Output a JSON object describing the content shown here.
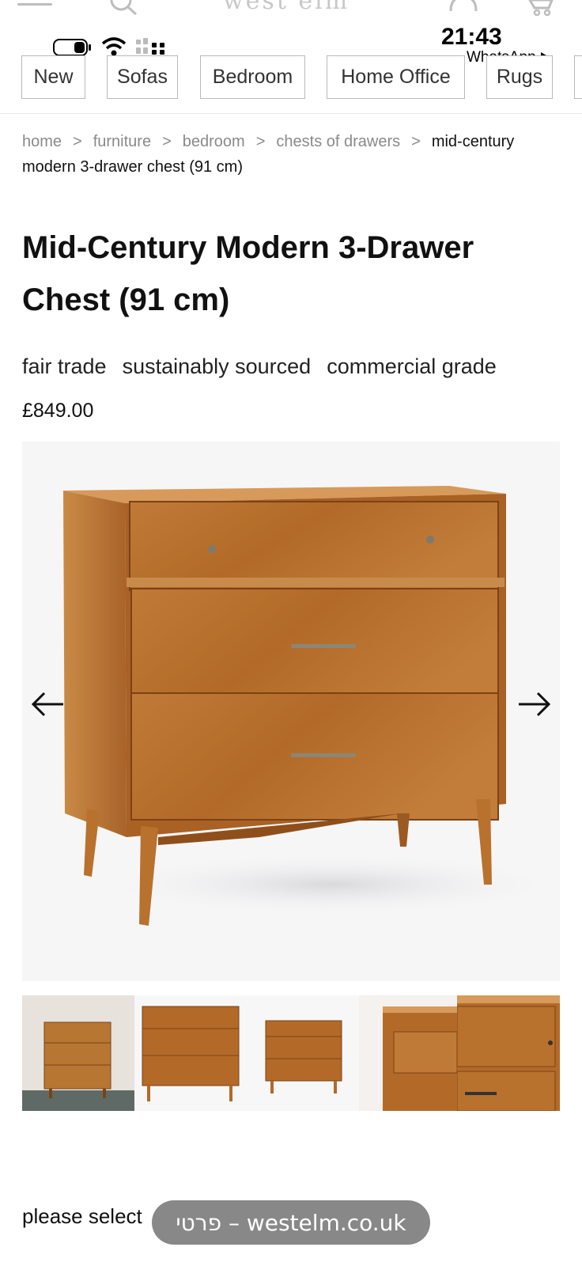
{
  "header": {
    "logo": "west elm",
    "icons": [
      "menu-icon",
      "search-icon",
      "account-icon",
      "cart-icon"
    ]
  },
  "status_bar": {
    "time": "21:43",
    "back_app": "WhatsApp"
  },
  "categories": [
    "New",
    "Sofas",
    "Bedroom",
    "Home Office",
    "Rugs"
  ],
  "breadcrumb": {
    "items": [
      "home",
      "furniture",
      "bedroom",
      "chests of drawers"
    ],
    "current_line1": "mid-century",
    "current_line2": "modern 3-drawer chest (91 cm)"
  },
  "product": {
    "title": "Mid-Century Modern 3-Drawer Chest (91 cm)",
    "tags": [
      "fair trade",
      "sustainably sourced",
      "commercial grade"
    ],
    "price": "£849.00"
  },
  "gallery": {
    "prev_icon": "arrow-left-icon",
    "next_icon": "arrow-right-icon",
    "thumbnails": 5
  },
  "footer": {
    "please_select": "please select",
    "url_pill": "פרטי – westelm.co.uk"
  },
  "colors": {
    "wood": "#b9712e",
    "wood_dark": "#8f4f1a",
    "chip_border": "#b9b9b9",
    "pill": "#7a7a7a"
  }
}
